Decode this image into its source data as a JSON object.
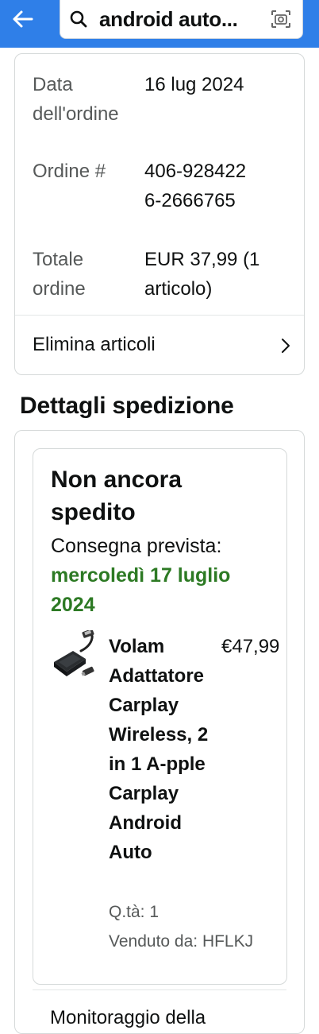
{
  "header": {
    "search_query": "android auto..."
  },
  "order": {
    "date_label": "Data dell'ordine",
    "date_value": "16 lug 2024",
    "number_label": "Ordine #",
    "number_value": "406-9284226-2666765",
    "total_label": "Totale ordine",
    "total_value": "EUR 37,99 (1 articolo)",
    "delete_label": "Elimina articoli"
  },
  "shipping": {
    "section_title": "Dettagli spedizione",
    "status": "Non ancora spedito",
    "eta_label": "Consegna prevista:",
    "eta_date": "mercoledì 17 luglio 2024",
    "item": {
      "title": "Volam Adattatore Carplay Wireless, 2 in 1 A-pple Carplay Android Auto",
      "price": "€47,99",
      "quantity": "Q.tà: 1",
      "seller": "Venduto da: HFLKJ"
    },
    "tracking_label": "Monitoraggio della"
  },
  "colors": {
    "header_bg": "#2f7fe8",
    "eta_green": "#2d7a24"
  }
}
